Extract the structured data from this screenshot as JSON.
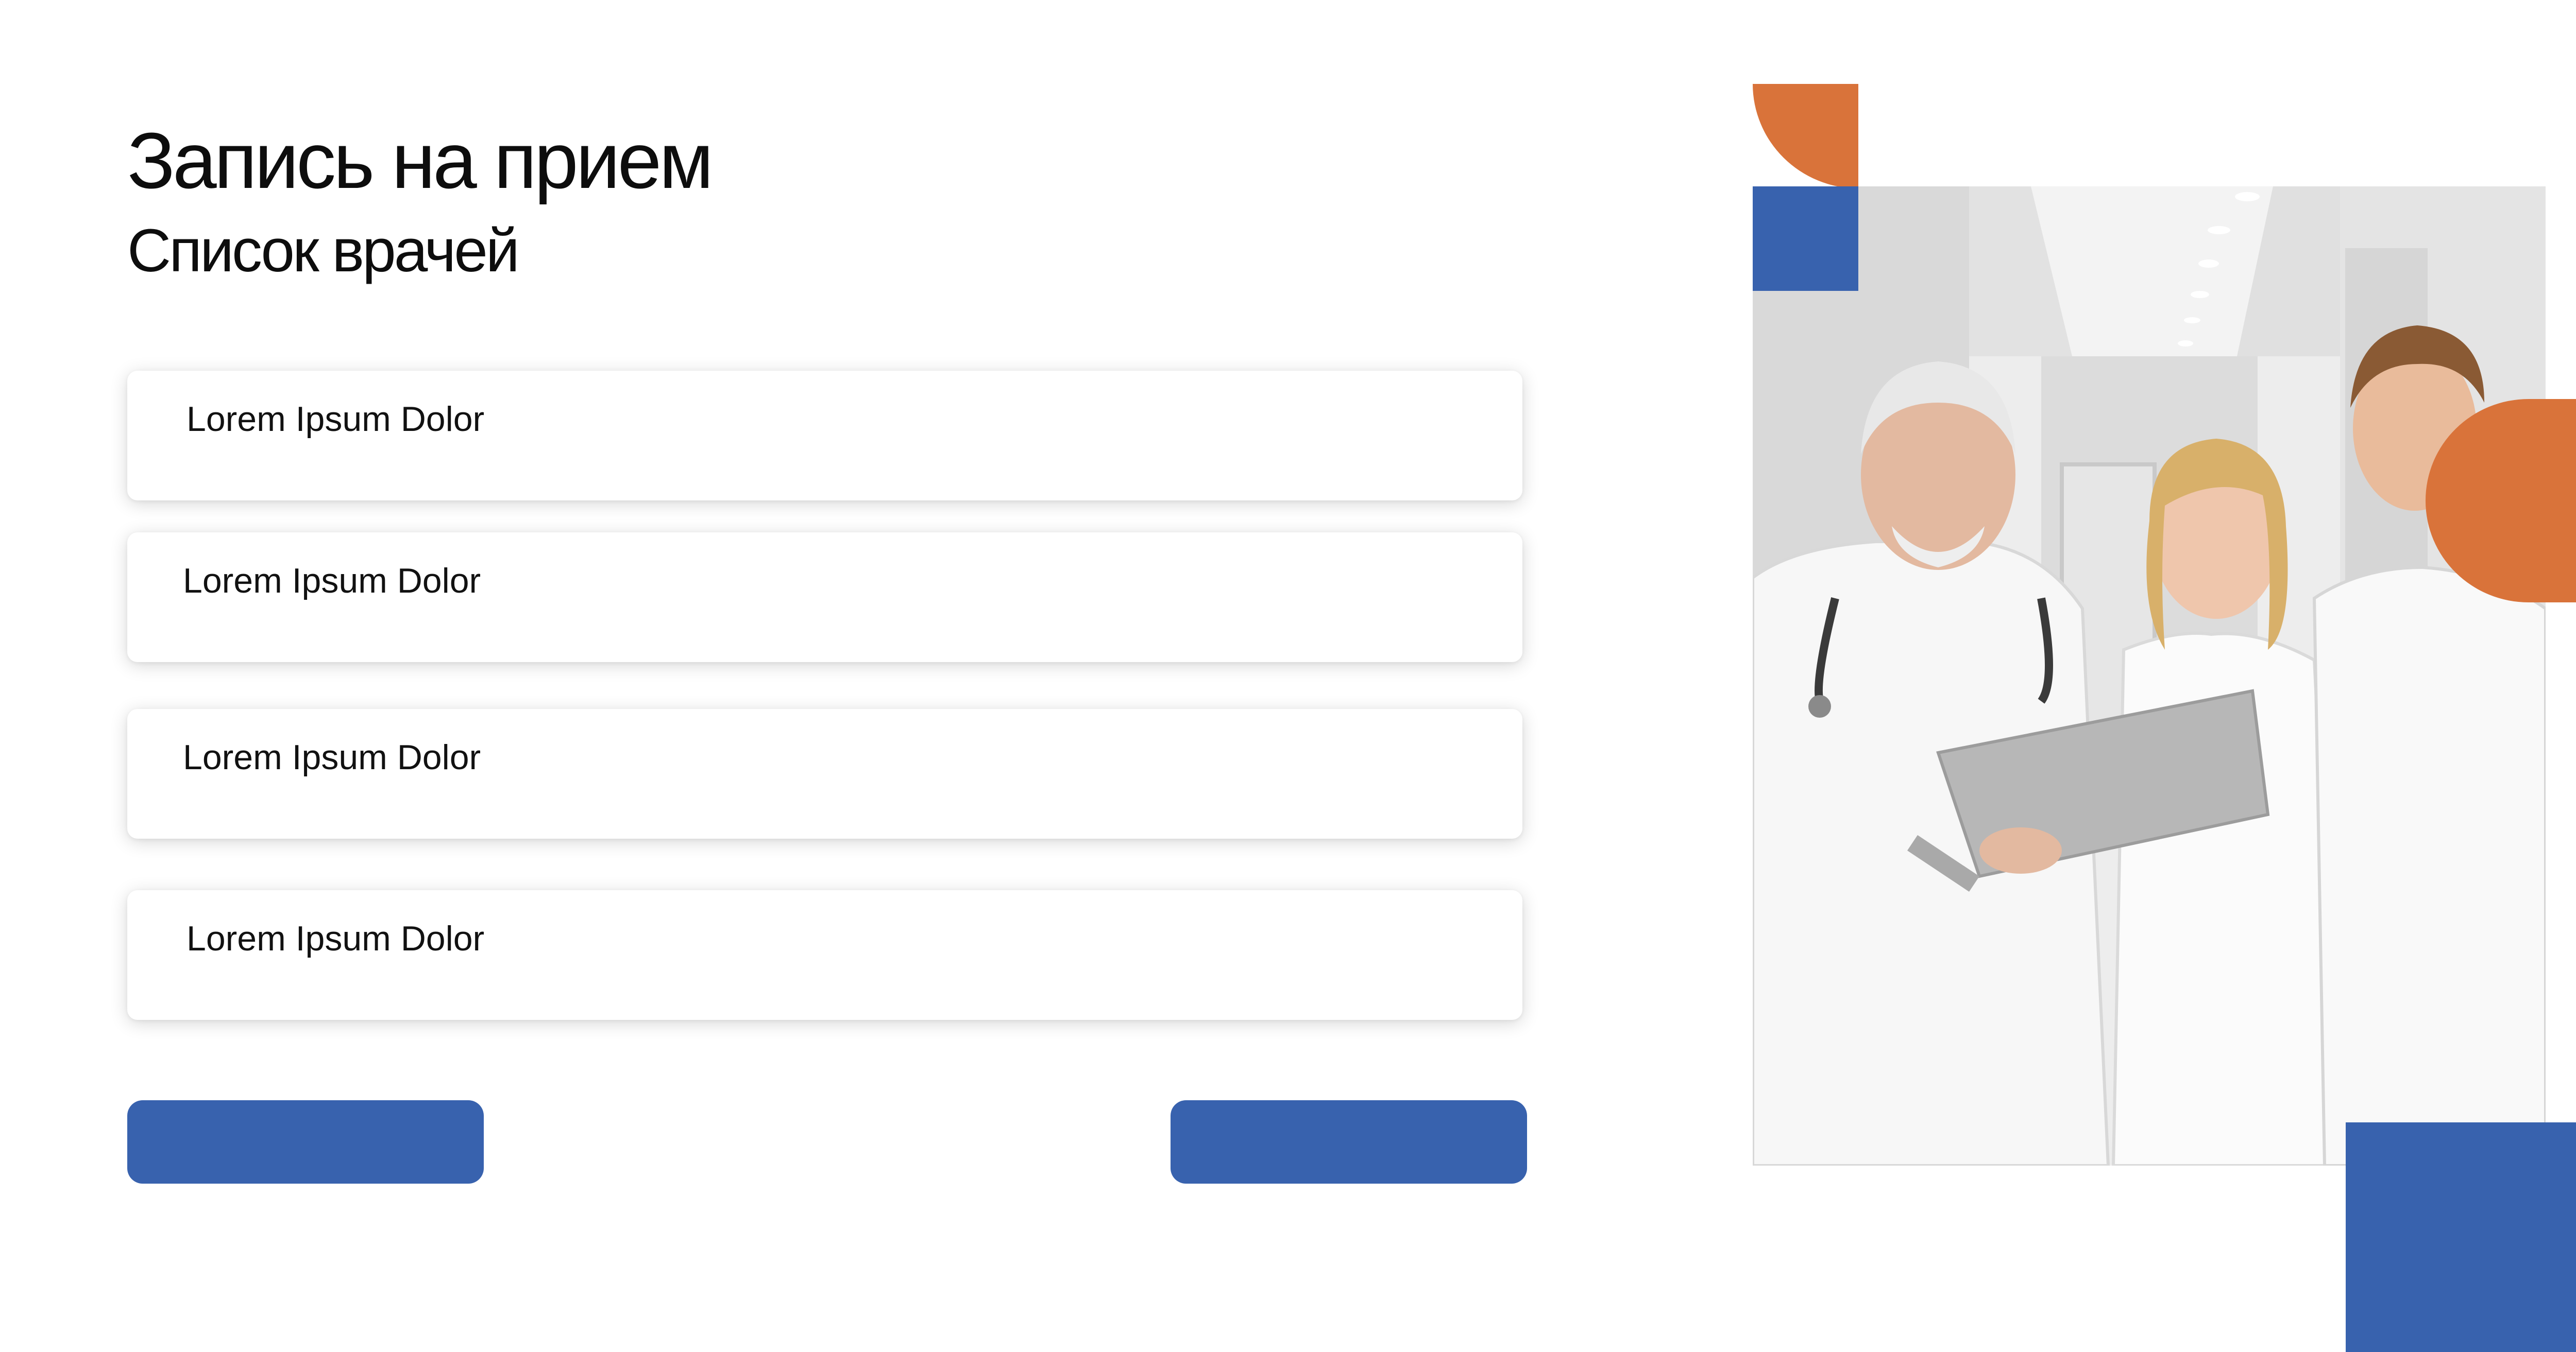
{
  "header": {
    "title": "Запись на прием",
    "subtitle": "Список врачей"
  },
  "doctors": [
    {
      "name": "Lorem Ipsum Dolor"
    },
    {
      "name": "Lorem Ipsum Dolor"
    },
    {
      "name": "Lorem Ipsum Dolor"
    },
    {
      "name": "Lorem Ipsum Dolor"
    }
  ],
  "buttons": {
    "back_label": "",
    "next_label": ""
  },
  "colors": {
    "accent_blue": "#3862ae",
    "accent_orange": "#d9733a",
    "text": "#0d0d0d"
  }
}
